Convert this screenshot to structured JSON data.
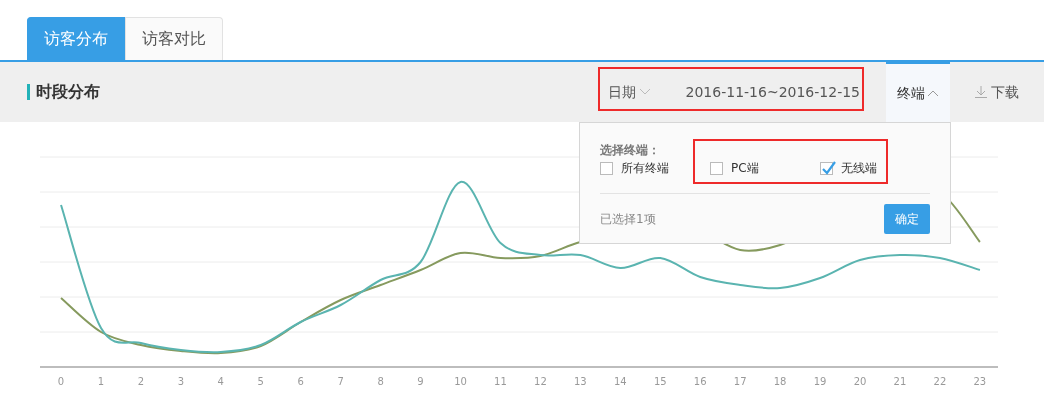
{
  "tabs": [
    {
      "label": "访客分布",
      "selected": true
    },
    {
      "label": "访客对比",
      "selected": false
    }
  ],
  "section_title": "时段分布",
  "date_filter": {
    "label": "日期",
    "value": "2016-11-16~2016-12-15"
  },
  "terminal_button": {
    "label": "终端",
    "expanded": true
  },
  "download_button": {
    "label": "下载"
  },
  "terminal_dropdown": {
    "title": "选择终端：",
    "options": [
      {
        "label": "所有终端",
        "checked": false
      },
      {
        "label": "PC端",
        "checked": false
      },
      {
        "label": "无线端",
        "checked": true
      }
    ],
    "summary": "已选择1项",
    "confirm": "确定"
  },
  "chart": {
    "x_labels": [
      "0",
      "1",
      "2",
      "3",
      "4",
      "5",
      "6",
      "7",
      "8",
      "9",
      "10",
      "11",
      "12",
      "13",
      "14",
      "15",
      "16",
      "17",
      "18",
      "19",
      "20",
      "21",
      "22",
      "23"
    ]
  }
}
